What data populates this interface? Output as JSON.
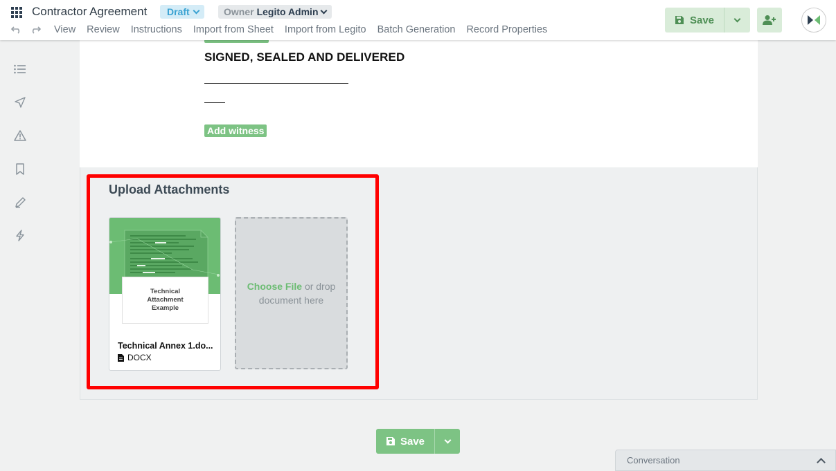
{
  "header": {
    "doc_title": "Contractor Agreement",
    "status": "Draft",
    "owner_label": "Owner",
    "owner_value": "Legito Admin",
    "menu": [
      "View",
      "Review",
      "Instructions",
      "Import from Sheet",
      "Import from Legito",
      "Batch Generation",
      "Record Properties"
    ],
    "save_label": "Save"
  },
  "sidebar": {
    "icons": [
      "list-icon",
      "send-icon",
      "warning-icon",
      "bookmark-icon",
      "pen-icon",
      "lightning-icon"
    ]
  },
  "document": {
    "heading": "SIGNED, SEALED AND DELIVERED",
    "add_witness": "Add witness"
  },
  "attachments": {
    "title": "Upload Attachments",
    "files": [
      {
        "thumb_caption": "Technical Attachment Example",
        "name": "Technical Annex 1.do...",
        "type": "DOCX"
      }
    ],
    "dropzone_choose": "Choose File",
    "dropzone_rest": "or drop document here"
  },
  "footer": {
    "save_label": "Save",
    "conversation_label": "Conversation"
  },
  "colors": {
    "accent": "#7dc384",
    "highlight": "#ff0000",
    "status": "#3aa2d2"
  }
}
